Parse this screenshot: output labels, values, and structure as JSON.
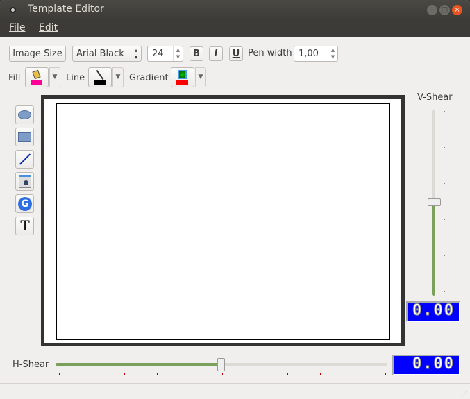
{
  "window": {
    "title": "Template Editor"
  },
  "menu": {
    "file": "File",
    "edit": "Edit"
  },
  "toolbar": {
    "image_size": "Image Size",
    "font": "Arial Black",
    "font_size": "24",
    "bold": "B",
    "italic": "I",
    "underline": "U",
    "pen_width_label": "Pen width",
    "pen_width": "1,00"
  },
  "colors": {
    "fill_label": "Fill",
    "line_label": "Line",
    "gradient_label": "Gradient",
    "fill_color": "#ff0099",
    "line_color": "#000000",
    "gradient_color": "#ff0000"
  },
  "tools": [
    "ellipse-icon",
    "rectangle-icon",
    "line-icon",
    "image-icon",
    "rotate-icon",
    "text-icon"
  ],
  "vshear": {
    "label": "V-Shear",
    "value_display": "0.00",
    "value": 0.5
  },
  "hshear": {
    "label": "H-Shear",
    "value_display": "0.00",
    "value": 0.5
  }
}
